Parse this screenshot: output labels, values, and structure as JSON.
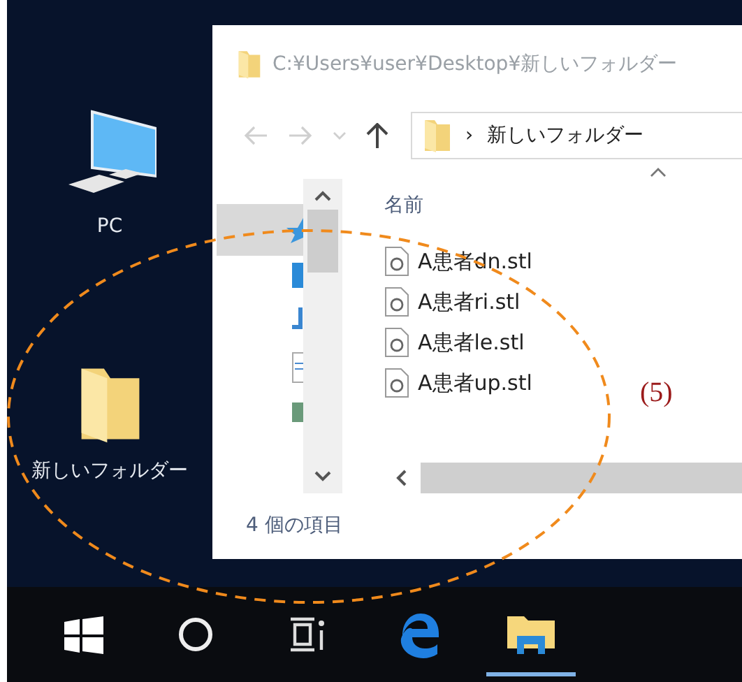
{
  "desktop_icons": [
    {
      "kind": "pc",
      "label": "PC"
    },
    {
      "kind": "folder",
      "label": "新しいフォルダー"
    }
  ],
  "explorer": {
    "title": "C:¥Users¥user¥Desktop¥新しいフォルダー",
    "address": {
      "separator": "›",
      "path": "新しいフォルダー"
    },
    "column_header": "名前",
    "files": [
      {
        "name": "A患者dn.stl"
      },
      {
        "name": "A患者ri.stl"
      },
      {
        "name": "A患者le.stl"
      },
      {
        "name": "A患者up.stl"
      }
    ],
    "status_bar": "4 個の項目"
  },
  "annotation": {
    "label": "(5)"
  },
  "taskbar": [
    {
      "kind": "start",
      "selected": false
    },
    {
      "kind": "search",
      "selected": false
    },
    {
      "kind": "taskview",
      "selected": false
    },
    {
      "kind": "browser",
      "selected": false
    },
    {
      "kind": "explorer",
      "selected": true
    }
  ]
}
